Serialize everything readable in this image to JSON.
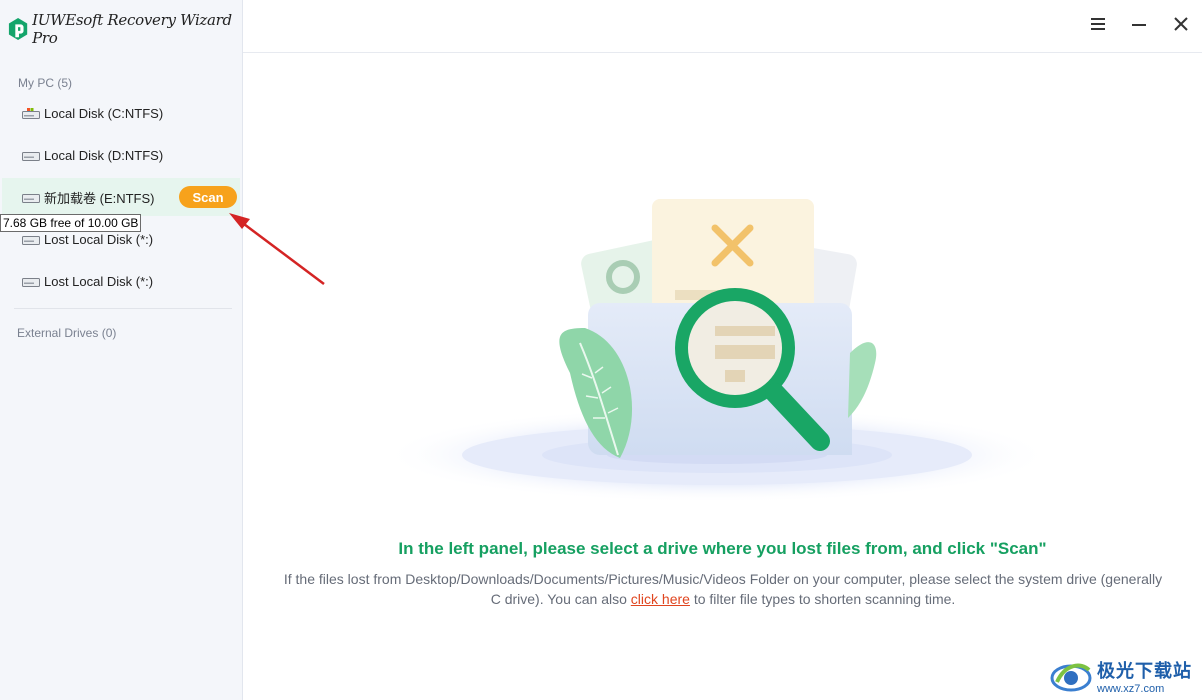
{
  "app": {
    "title": "IUWEsoft Recovery Wizard Pro"
  },
  "window_controls": {
    "menu_icon": "hamburger-icon",
    "minimize_icon": "minimize-icon",
    "close_icon": "close-icon"
  },
  "sidebar": {
    "my_pc_label": "My PC (5)",
    "drives": [
      {
        "label": "Local Disk (C:NTFS)",
        "icon": "windows-disk-icon"
      },
      {
        "label": "Local Disk (D:NTFS)",
        "icon": "disk-icon"
      },
      {
        "label": "新加载卷 (E:NTFS)",
        "icon": "disk-icon",
        "selected": true
      },
      {
        "label": "Lost Local Disk (*:)",
        "icon": "disk-icon"
      },
      {
        "label": "Lost Local Disk (*:)",
        "icon": "disk-icon"
      }
    ],
    "scan_label": "Scan",
    "tooltip": "7.68 GB free of 10.00 GB",
    "external_label": "External Drives (0)"
  },
  "main": {
    "headline": "In the left panel, please select a drive where you lost files from, and click \"Scan\"",
    "desc_before": "If the files lost from Desktop/Downloads/Documents/Pictures/Music/Videos Folder on your computer, please select the system drive (generally C drive). You can also ",
    "link_text": "click here",
    "desc_after": " to filter file types to shorten scanning time."
  },
  "watermark": {
    "title": "极光下载站",
    "url": "www.xz7.com"
  },
  "colors": {
    "accent_green": "#16a061",
    "scan_orange": "#f7a21b",
    "link_red": "#e0451f",
    "selected_bg": "#e6f5ee"
  }
}
